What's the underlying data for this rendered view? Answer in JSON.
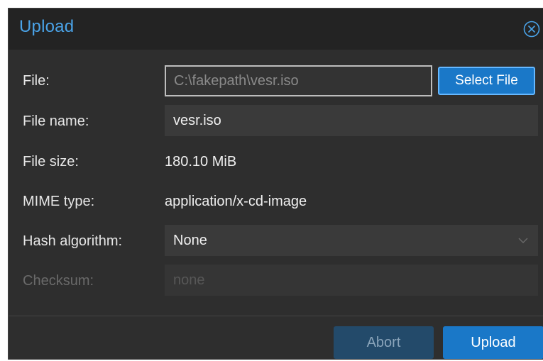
{
  "dialog": {
    "title": "Upload",
    "close_icon": "close-circle-icon"
  },
  "form": {
    "file": {
      "label": "File:",
      "value": "C:\\fakepath\\vesr.iso",
      "button_label": "Select File"
    },
    "file_name": {
      "label": "File name:",
      "value": "vesr.iso"
    },
    "file_size": {
      "label": "File size:",
      "value": "180.10 MiB"
    },
    "mime_type": {
      "label": "MIME type:",
      "value": "application/x-cd-image"
    },
    "hash_algorithm": {
      "label": "Hash algorithm:",
      "value": "None",
      "icon": "chevron-down-icon"
    },
    "checksum": {
      "label": "Checksum:",
      "placeholder": "none"
    }
  },
  "footer": {
    "abort_label": "Abort",
    "upload_label": "Upload"
  },
  "colors": {
    "accent": "#1a78c8",
    "title": "#4aa3e8",
    "background": "#2e2e2e"
  }
}
